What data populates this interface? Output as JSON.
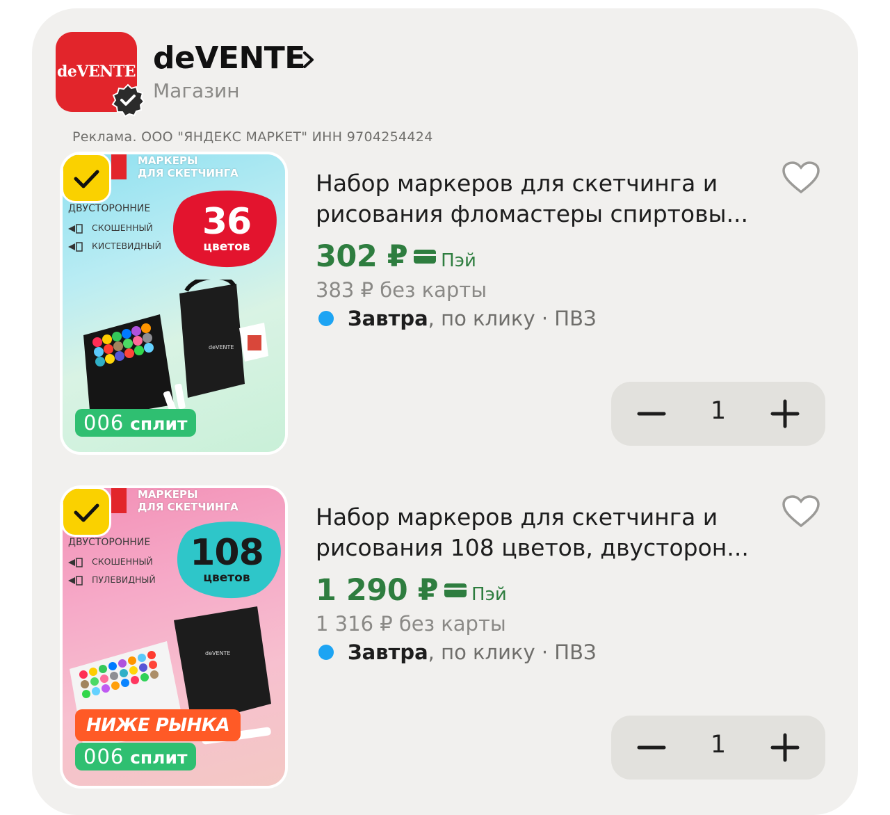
{
  "shop": {
    "logo_text": "deVENTE",
    "name": "deVENTE",
    "subtitle": "Магазин"
  },
  "ad_note": "Реклама. ООО \"ЯНДЕКС МАРКЕТ\" ИНН 9704254424",
  "products": [
    {
      "image": {
        "header_line1": "МАРКЕРЫ",
        "header_line2": "ДЛЯ СКЕТЧИНГА",
        "feature_title": "ДВУСТОРОННИЕ",
        "feature_1": "СКОШЕННЫЙ",
        "feature_2": "КИСТЕВИДНЫЙ",
        "badge_number": "36",
        "badge_word": "цветов",
        "split_num": "006",
        "split_word": "сплит",
        "badge_color": "#e3142e"
      },
      "title_line1": "Набор маркеров для скетчинга и",
      "title_line2": "рисования фломастеры спиртовы...",
      "price": "302 ₽",
      "pay_label": "Пэй",
      "old_price": "383 ₽  без карты",
      "delivery_bold": "Завтра",
      "delivery_rest": ", по клику · ПВЗ",
      "quantity": "1"
    },
    {
      "image": {
        "header_line1": "МАРКЕРЫ",
        "header_line2": "ДЛЯ СКЕТЧИНГА",
        "feature_title": "ДВУСТОРОННИЕ",
        "feature_1": "СКОШЕННЫЙ",
        "feature_2": "ПУЛЕВИДНЫЙ",
        "badge_number": "108",
        "badge_word": "цветов",
        "below_market": "НИЖЕ РЫНКА",
        "split_num": "006",
        "split_word": "сплит",
        "badge_color": "#2ec6c9"
      },
      "title_line1": "Набор маркеров для скетчинга и",
      "title_line2": "рисования 108 цветов, двусторон...",
      "price": "1 290 ₽",
      "pay_label": "Пэй",
      "old_price": "1 316 ₽  без карты",
      "delivery_bold": "Завтра",
      "delivery_rest": ", по клику · ПВЗ",
      "quantity": "1"
    }
  ],
  "colors": {
    "price_green": "#2e7d3f",
    "check_yellow": "#fad100",
    "split_green": "#2fbf71",
    "brand_red": "#e2252b",
    "delivery_dot": "#1da4f3"
  },
  "icons": [
    "verified-icon",
    "chevron-right-icon",
    "heart-icon",
    "check-icon",
    "pay-card-icon",
    "minus-icon",
    "plus-icon"
  ]
}
